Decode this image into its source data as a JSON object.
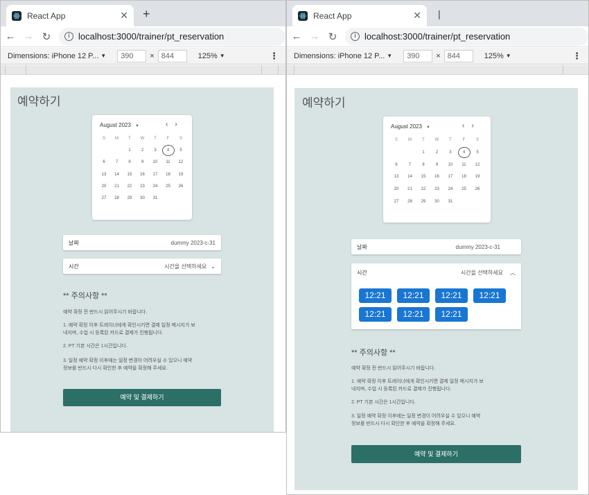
{
  "browser": {
    "tab_title": "React App",
    "new_tab": "+",
    "url": "localhost:3000/trainer/pt_reservation",
    "device": "Dimensions: iPhone 12 P...",
    "width": "390",
    "times": "×",
    "height": "844",
    "zoom": "125%"
  },
  "page": {
    "title": "예약하기",
    "calendar": {
      "month_label": "August 2023",
      "weekdays": [
        "S",
        "M",
        "T",
        "W",
        "T",
        "F",
        "S"
      ],
      "days": [
        "1",
        "2",
        "3",
        "4",
        "5",
        "6",
        "7",
        "8",
        "9",
        "10",
        "11",
        "12",
        "13",
        "14",
        "15",
        "16",
        "17",
        "18",
        "19",
        "20",
        "21",
        "22",
        "23",
        "24",
        "25",
        "26",
        "27",
        "28",
        "29",
        "30",
        "31"
      ],
      "first_weekday": 2,
      "today": "4"
    },
    "date_field": {
      "label": "날짜",
      "value": "dummy 2023-c-31"
    },
    "time_field": {
      "label": "시간",
      "placeholder": "시간을 선택하세요"
    },
    "time_slots": [
      "12:21",
      "12:21",
      "12:21",
      "12:21",
      "12:21",
      "12:21",
      "12:21"
    ],
    "notice_left": {
      "title": "** 주의사항 **",
      "intro": "예약 확정 전 반드시 읽어주시기 바랍니다.",
      "items": [
        "1. 예약 확정 이후 트레이너에게 확인시키면 결제 일정 메시지가 보",
        "내지며, 수업 시 등록된 카드로 결제가 진행됩니다.",
        "2. PT 기본 시간은 1시간입니다.",
        "3. 일정 예약 확정 이후에는 일정 변경이 어려우실 수 있으니 예약",
        "정보를 반드시 다시 확인한 후 예약을 확정해 주세요."
      ]
    },
    "notice_right": {
      "title": "** 주의사항 **",
      "intro": "예약 확정 전 반드시 읽어주시기 바랍니다.",
      "items": [
        "1. 예약 확정 이후 트레이너에게 확인시키면 결제 일정 메시지가 보",
        "내지며, 수업 시 등록된 카드로 결제가 진행됩니다.",
        "2. PT 기본 시간은 1시간입니다.",
        "3. 일정 예약 확정 이후에는 일정 변경이 어려우실 수 있으니 예약",
        "정보를 반드시 다시 확인한 후 예약을 확정해 주세요."
      ]
    },
    "submit": "예약 및 결제하기"
  },
  "colors": {
    "page_bg": "#d8e3e3",
    "primary": "#1976d2",
    "submit": "#2c6f66"
  }
}
